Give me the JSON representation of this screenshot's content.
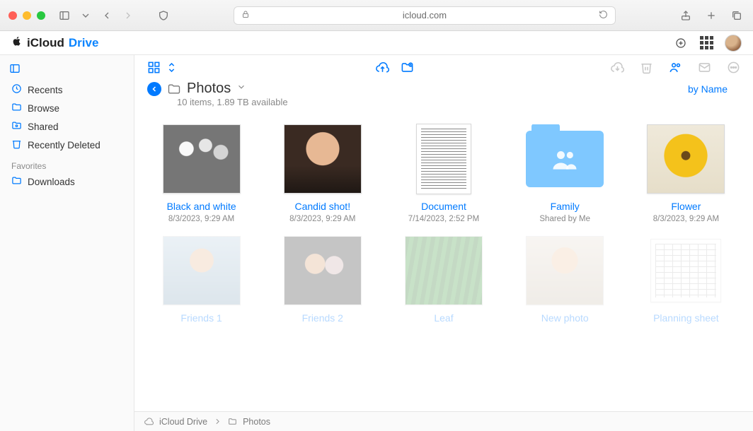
{
  "browser": {
    "url": "icloud.com"
  },
  "brand": {
    "name": "iCloud",
    "suffix": "Drive"
  },
  "sidebar": {
    "items": [
      {
        "icon": "clock",
        "label": "Recents"
      },
      {
        "icon": "folder",
        "label": "Browse"
      },
      {
        "icon": "shared",
        "label": "Shared"
      },
      {
        "icon": "trash",
        "label": "Recently Deleted"
      }
    ],
    "favorites_label": "Favorites",
    "favorites": [
      {
        "icon": "folder",
        "label": "Downloads"
      }
    ]
  },
  "location": {
    "title": "Photos",
    "subtitle": "10 items, 1.89 TB available",
    "sort_label": "by Name"
  },
  "files": [
    {
      "name": "Black and white",
      "meta": "8/3/2023, 9:29 AM",
      "kind": "image",
      "thumb": "bw"
    },
    {
      "name": "Candid shot!",
      "meta": "8/3/2023, 9:29 AM",
      "kind": "image",
      "thumb": "candid"
    },
    {
      "name": "Document",
      "meta": "7/14/2023, 2:52 PM",
      "kind": "doc"
    },
    {
      "name": "Family",
      "meta": "Shared by Me",
      "kind": "folder"
    },
    {
      "name": "Flower",
      "meta": "8/3/2023, 9:29 AM",
      "kind": "image",
      "thumb": "flower"
    },
    {
      "name": "Friends 1",
      "meta": "",
      "kind": "image",
      "thumb": "friends1",
      "faded": true
    },
    {
      "name": "Friends 2",
      "meta": "",
      "kind": "image",
      "thumb": "friends2",
      "faded": true
    },
    {
      "name": "Leaf",
      "meta": "",
      "kind": "image",
      "thumb": "leaf",
      "faded": true
    },
    {
      "name": "New photo",
      "meta": "",
      "kind": "image",
      "thumb": "newphoto",
      "faded": true
    },
    {
      "name": "Planning sheet",
      "meta": "",
      "kind": "sheet",
      "faded": true
    }
  ],
  "breadcrumb": {
    "root": "iCloud Drive",
    "current": "Photos"
  }
}
